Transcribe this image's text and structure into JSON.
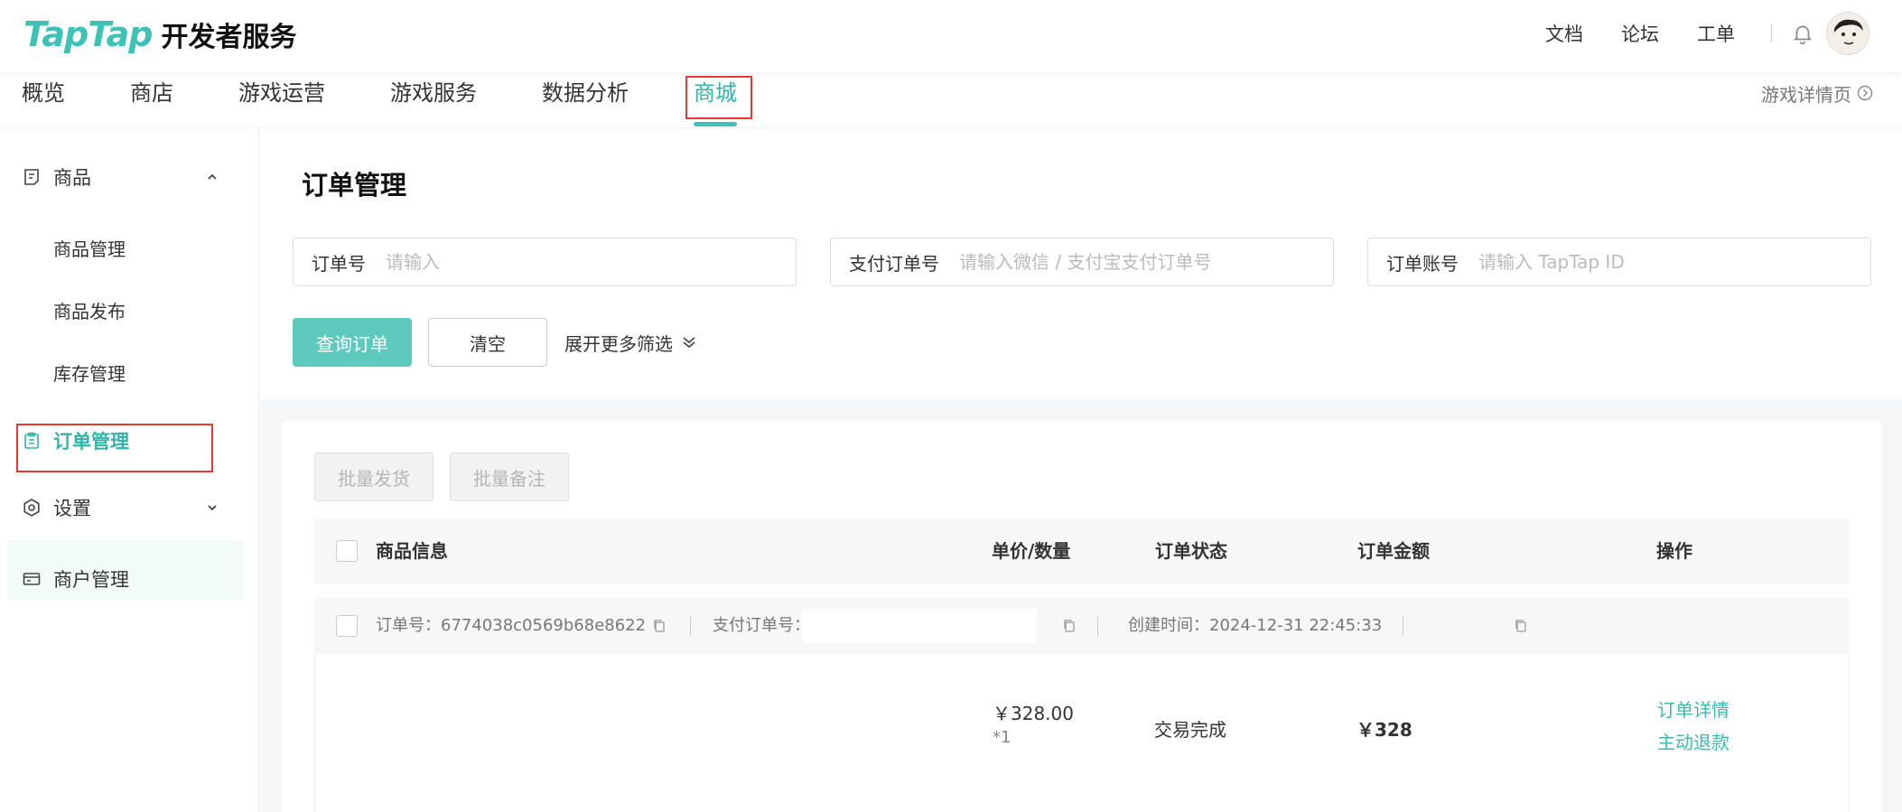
{
  "brand": {
    "logo_text": "TapTap",
    "subtitle": "开发者服务"
  },
  "top_links": {
    "docs": "文档",
    "forum": "论坛",
    "tickets": "工单"
  },
  "nav": {
    "items": [
      "概览",
      "商店",
      "游戏运营",
      "游戏服务",
      "数据分析",
      "商城"
    ],
    "active_index": 5,
    "game_detail": "游戏详情页"
  },
  "sidebar": {
    "goods": {
      "label": "商品",
      "children": [
        "商品管理",
        "商品发布",
        "库存管理"
      ]
    },
    "orders": {
      "label": "订单管理"
    },
    "settings": {
      "label": "设置"
    },
    "merchant": {
      "label": "商户管理"
    }
  },
  "page": {
    "title": "订单管理"
  },
  "filters": {
    "order_no": {
      "label": "订单号",
      "placeholder": "请输入"
    },
    "pay_order_no": {
      "label": "支付订单号",
      "placeholder": "请输入微信 / 支付宝支付订单号"
    },
    "account": {
      "label": "订单账号",
      "placeholder": "请输入 TapTap ID"
    },
    "query_btn": "查询订单",
    "clear_btn": "清空",
    "expand": "展开更多筛选"
  },
  "batch": {
    "ship": "批量发货",
    "note": "批量备注"
  },
  "table": {
    "headers": {
      "goods_info": "商品信息",
      "price_qty": "单价/数量",
      "status": "订单状态",
      "amount": "订单金额",
      "actions": "操作"
    }
  },
  "order": {
    "order_no_text": "订单号：6774038c0569b68e8622",
    "pay_no_label": "支付订单号：",
    "created_text": "创建时间：2024-12-31 22:45:33",
    "unit_price": "￥328.00",
    "qty": "*1",
    "status": "交易完成",
    "amount": "￥328",
    "detail_link": "订单详情",
    "refund_link": "主动退款"
  },
  "colors": {
    "accent": "#3cc2b7",
    "highlight": "#e53935"
  }
}
